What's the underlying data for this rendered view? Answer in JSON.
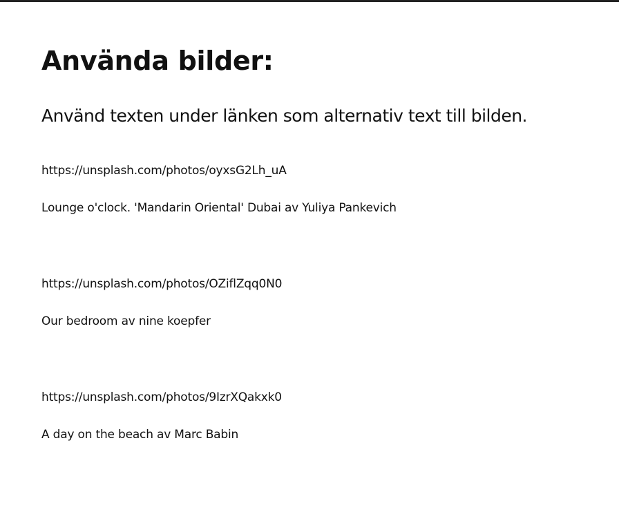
{
  "page": {
    "title": "Använda bilder:",
    "subtitle": "Använd texten under länken som alternativ text till bilden."
  },
  "entries": [
    {
      "url": "https://unsplash.com/photos/oyxsG2Lh_uA",
      "caption": "Lounge o'clock. 'Mandarin Oriental' Dubai av  Yuliya Pankevich"
    },
    {
      "url": "https://unsplash.com/photos/OZiflZqq0N0",
      "caption": "Our bedroom av nine koepfer"
    },
    {
      "url": "https://unsplash.com/photos/9IzrXQakxk0",
      "caption": "A day on the beach av Marc Babin"
    }
  ]
}
